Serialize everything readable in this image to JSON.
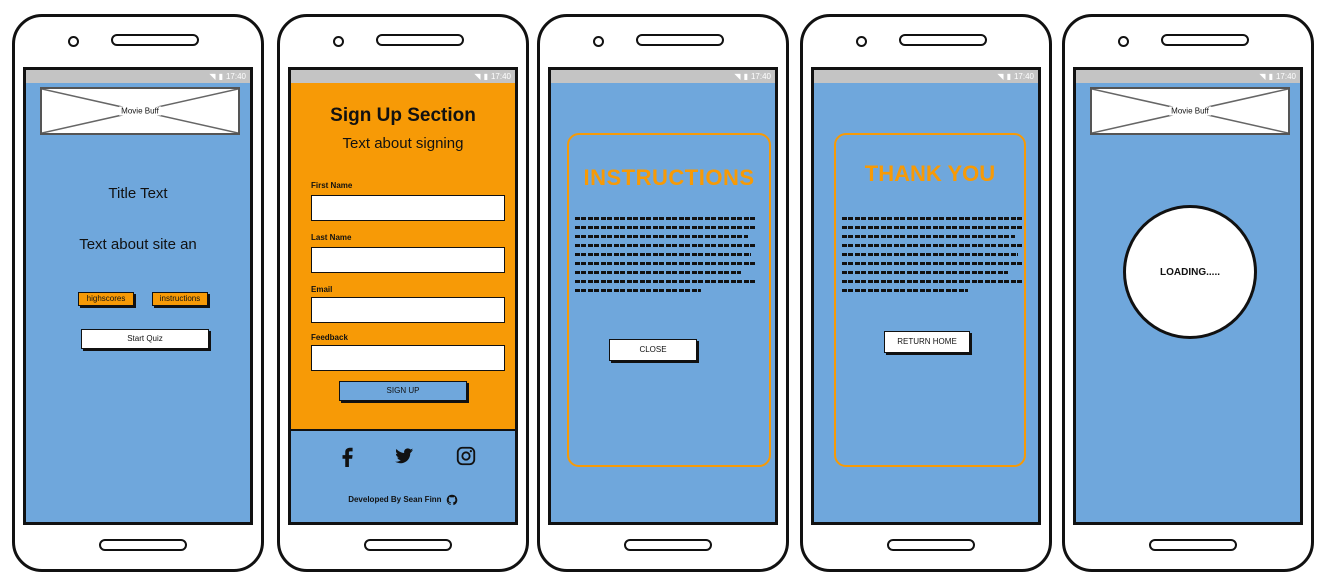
{
  "status_time": "17:40",
  "phone1": {
    "logo_label": "Movie Buff",
    "title": "Title Text",
    "subtitle": "Text about site an",
    "highscores_label": "highscores",
    "instructions_label": "instructions",
    "start_label": "Start Quiz"
  },
  "phone2": {
    "heading": "Sign Up Section",
    "subheading": "Text about signing",
    "first_name_label": "First Name",
    "last_name_label": "Last Name",
    "email_label": "Email",
    "feedback_label": "Feedback",
    "signup_label": "SIGN UP",
    "footer_text": "Developed By Sean Finn"
  },
  "phone3": {
    "heading": "INSTRUCTIONS",
    "close_label": "CLOSE"
  },
  "phone4": {
    "heading": "THANK YOU",
    "return_label": "RETURN HOME"
  },
  "phone5": {
    "logo_label": "Movie Buff",
    "loading_text": "LOADING....."
  },
  "colors": {
    "screen_blue": "#6fa7dc",
    "accent_orange": "#f79a06"
  },
  "icons": [
    "facebook-icon",
    "twitter-icon",
    "instagram-icon",
    "github-icon"
  ]
}
